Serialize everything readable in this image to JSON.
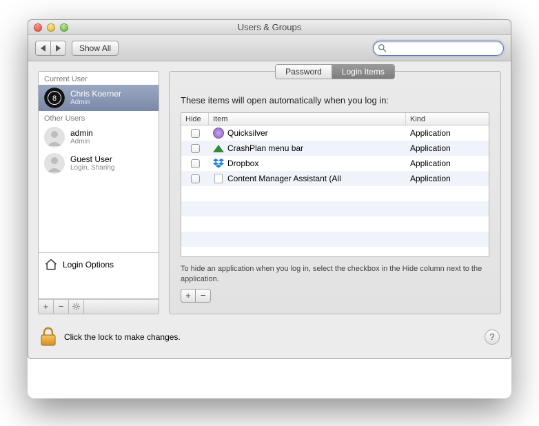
{
  "window": {
    "title": "Users & Groups"
  },
  "toolbar": {
    "show_all": "Show All",
    "search_placeholder": ""
  },
  "sidebar": {
    "current_label": "Current User",
    "other_label": "Other Users",
    "login_options": "Login Options",
    "users": [
      {
        "name": "Chris Koerner",
        "role": "Admin",
        "selected": true,
        "avatar": "billiard"
      },
      {
        "name": "admin",
        "role": "Admin",
        "selected": false,
        "avatar": "silhouette"
      },
      {
        "name": "Guest User",
        "role": "Login, Sharing",
        "selected": false,
        "avatar": "silhouette"
      }
    ]
  },
  "tabs": {
    "password": "Password",
    "login_items": "Login Items",
    "active": "login_items"
  },
  "login_items": {
    "intro": "These items will open automatically when you log in:",
    "columns": {
      "hide": "Hide",
      "item": "Item",
      "kind": "Kind"
    },
    "rows": [
      {
        "hide": false,
        "item": "Quicksilver",
        "kind": "Application",
        "icon": "quicksilver"
      },
      {
        "hide": false,
        "item": "CrashPlan menu bar",
        "kind": "Application",
        "icon": "crashplan"
      },
      {
        "hide": false,
        "item": "Dropbox",
        "kind": "Application",
        "icon": "dropbox"
      },
      {
        "hide": false,
        "item": "Content Manager Assistant (All",
        "kind": "Application",
        "icon": "document"
      }
    ],
    "hint": "To hide an application when you log in, select the checkbox in the Hide column next to the application."
  },
  "footer": {
    "lock_text": "Click the lock to make changes."
  }
}
